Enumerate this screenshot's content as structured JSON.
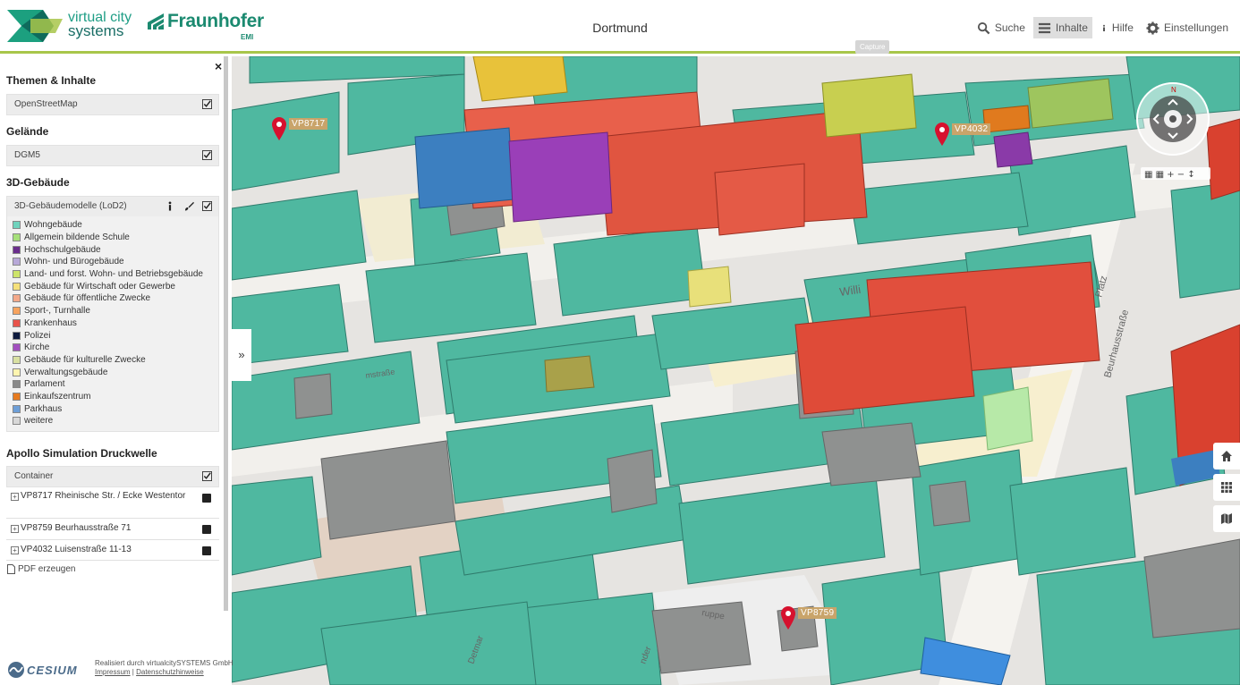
{
  "header": {
    "brand_vcs_line1": "virtual city",
    "brand_vcs_line2": "systems",
    "brand_fh": "Fraunhofer",
    "brand_emi": "EMI",
    "city": "Dortmund",
    "nav": [
      {
        "label": "Suche",
        "icon": "search-icon"
      },
      {
        "label": "Inhalte",
        "icon": "list-icon",
        "active": true
      },
      {
        "label": "Hilfe",
        "icon": "info-icon"
      },
      {
        "label": "Einstellungen",
        "icon": "gear-icon"
      }
    ],
    "tooltip": "Capture"
  },
  "sidebar": {
    "close": "×",
    "sections": {
      "themen": "Themen & Inhalte",
      "gelaende": "Gelände",
      "gebaeude": "3D-Gebäude",
      "apollo": "Apollo Simulation Druckwelle"
    },
    "layers": {
      "osm": "OpenStreetMap",
      "dgm": "DGM5",
      "lod2": "3D-Gebäudemodelle (LoD2)",
      "container": "Container"
    },
    "legend": [
      {
        "label": "Wohngebäude",
        "color": "#6fd3bd"
      },
      {
        "label": "Allgemein bildende Schule",
        "color": "#a6e07a"
      },
      {
        "label": "Hochschulgebäude",
        "color": "#6a2d8c"
      },
      {
        "label": "Wohn- und Bürogebäude",
        "color": "#b7a8d8"
      },
      {
        "label": "Land- und forst. Wohn- und Betriebsgebäude",
        "color": "#cde46a"
      },
      {
        "label": "Gebäude für Wirtschaft oder Gewerbe",
        "color": "#f5e07a"
      },
      {
        "label": "Gebäude für öffentliche Zwecke",
        "color": "#f4a98a"
      },
      {
        "label": "Sport-, Turnhalle",
        "color": "#f7a35e"
      },
      {
        "label": "Krankenhaus",
        "color": "#e8534a"
      },
      {
        "label": "Polizei",
        "color": "#0d1a3d"
      },
      {
        "label": "Kirche",
        "color": "#a24fbf"
      },
      {
        "label": "Gebäude für kulturelle Zwecke",
        "color": "#d9e0a2"
      },
      {
        "label": "Verwaltungsgebäude",
        "color": "#fff5b0"
      },
      {
        "label": "Parlament",
        "color": "#8a8a8a"
      },
      {
        "label": "Einkaufszentrum",
        "color": "#e67a1e"
      },
      {
        "label": "Parkhaus",
        "color": "#6d9fd8"
      },
      {
        "label": "weitere",
        "color": "#d8d8d8"
      }
    ],
    "containers": [
      {
        "label": "VP8717 Rheinische Str. / Ecke Westentor"
      },
      {
        "label": "VP8759 Beurhausstraße 71"
      },
      {
        "label": "VP4032 Luisenstraße 11-13"
      }
    ],
    "pdf": "PDF erzeugen"
  },
  "map": {
    "markers": [
      {
        "label": "VP8717"
      },
      {
        "label": "VP4032"
      },
      {
        "label": "VP8759"
      }
    ],
    "collapse": "»",
    "street_labels": [
      "Willi",
      "mstraße",
      "Beurhausstraße",
      "Platz",
      "ruppe",
      "Detmar",
      "nder"
    ]
  },
  "footer": {
    "cesium": "CESIUM",
    "credit": "Realisiert durch virtualcitySYSTEMS GmbH",
    "impressum": "Impressum",
    "sep": " | ",
    "datenschutz": "Datenschutzhinweise"
  }
}
